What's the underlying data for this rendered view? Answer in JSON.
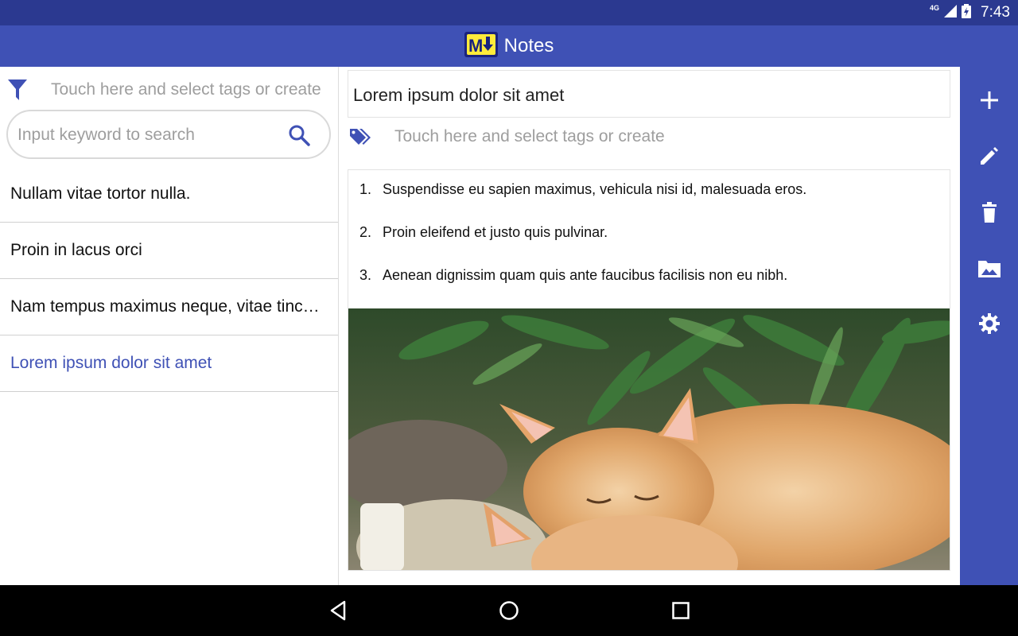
{
  "status_bar": {
    "network_type": "4G",
    "time": "7:43",
    "icons": [
      "signal-icon",
      "battery-charging-icon"
    ]
  },
  "app_bar": {
    "title": "Notes",
    "logo_text": "M",
    "logo_colors": {
      "background": "#ffeb3b",
      "foreground": "#1a237e"
    }
  },
  "filter": {
    "icon": "filter-icon",
    "placeholder": "Touch here and select tags or create"
  },
  "search": {
    "placeholder": "Input keyword to search",
    "icon": "search-icon"
  },
  "notes": [
    {
      "title": "Nullam vitae tortor nulla.",
      "active": false
    },
    {
      "title": "Proin in lacus orci",
      "active": false
    },
    {
      "title": "Nam tempus maximus neque, vitae tincidunt",
      "active": false
    },
    {
      "title": "Lorem ipsum dolor sit amet",
      "active": true
    }
  ],
  "editor": {
    "title": "Lorem ipsum dolor sit amet",
    "tags_placeholder": "Touch here and select tags or create",
    "tags_icon": "tags-icon",
    "list_items": [
      {
        "number": "1.",
        "text": "Suspendisse eu sapien maximus, vehicula nisi id, malesuada eros."
      },
      {
        "number": "2.",
        "text": "Proin eleifend et justo quis pulvinar."
      },
      {
        "number": "3.",
        "text": "Aenean dignissim quam quis ante faucibus facilisis non eu nibh."
      }
    ],
    "image_subject": "sleeping-kittens-photo"
  },
  "toolbar": [
    "add-icon",
    "edit-icon",
    "delete-icon",
    "image-icon",
    "settings-icon"
  ],
  "navigation": [
    "back-icon",
    "home-icon",
    "recents-icon"
  ],
  "colors": {
    "primary": "#3f51b5",
    "primary_dark": "#2b3990",
    "accent_text": "#3f51b5",
    "hint_text": "#9e9e9e"
  }
}
